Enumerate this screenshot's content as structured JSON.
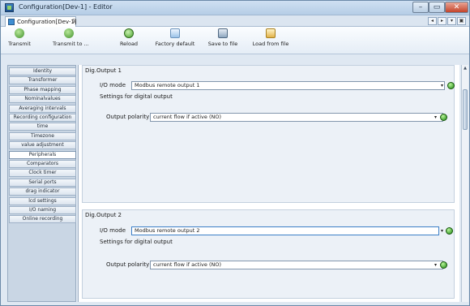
{
  "window": {
    "title": "Configuration[Dev-1] - Editor",
    "controls": {
      "minimize": "–",
      "maximize": "▭",
      "close": "✕"
    }
  },
  "tabs": {
    "doc_tab_label": "Configuration[Dev-1]",
    "doc_tab_close": "⊠",
    "strip_controls": [
      "◂",
      "▸",
      "▾",
      "▣"
    ]
  },
  "toolbar": {
    "transmit": "Transmit",
    "transmit_to": "Transmit to ...",
    "reload": "Reload",
    "factory_default": "Factory default",
    "save_to_file": "Save to file",
    "load_from_file": "Load from file"
  },
  "sidebar": {
    "active_index": 10,
    "items": [
      "Identity",
      "Transformer",
      "Phase mapping",
      "Nominalvalues",
      "Averaging intervals",
      "Recording configuration",
      "time",
      "Timezone",
      "value adjustment",
      "Peripherals",
      "Comparators",
      "Clock timer",
      "Serial ports",
      "drag indicator",
      "lcd settings",
      "I/O naming",
      "Online recording"
    ]
  },
  "outputs": [
    {
      "title": "Dig.Output 1",
      "io_mode_label": "I/O mode",
      "io_mode_value": "Modbus remote output 1",
      "settings_caption": "Settings for digital output",
      "polarity_label": "Output polarity",
      "polarity_value": "current flow if active (NO)"
    },
    {
      "title": "Dig.Output 2",
      "io_mode_label": "I/O mode",
      "io_mode_value": "Modbus remote output 2",
      "settings_caption": "Settings for digital output",
      "polarity_label": "Output polarity",
      "polarity_value": "current flow if active (NO)"
    }
  ],
  "dropdown_arrow": "▾",
  "scroll_up": "▲",
  "colors": {
    "status_led": "#1f8a14",
    "close_button": "#c4432a",
    "accent": "#3c7fc7"
  }
}
